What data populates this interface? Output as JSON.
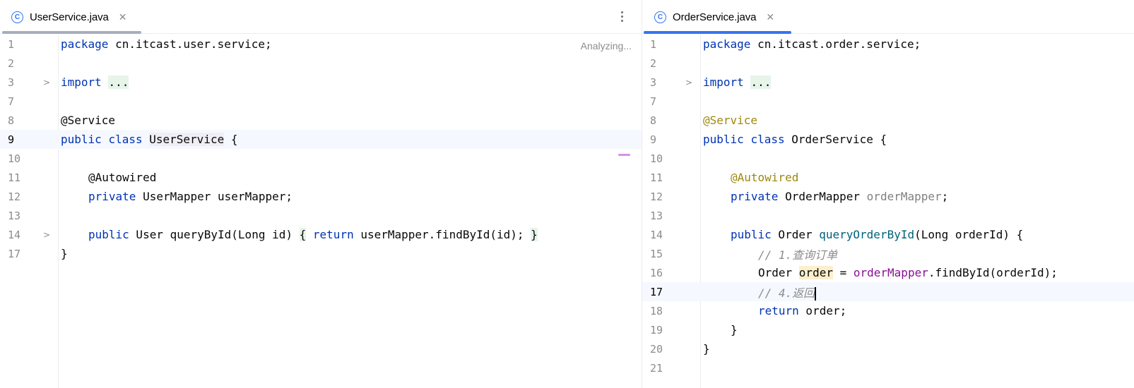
{
  "left": {
    "tab": {
      "icon": "class-icon",
      "icon_glyph": "C",
      "title": "UserService.java",
      "close": "✕"
    },
    "status": "Analyzing...",
    "lines": {
      "l1": {
        "no": "1",
        "kw": "package",
        "rest": " cn.itcast.user.service;"
      },
      "l2": {
        "no": "2"
      },
      "l3": {
        "no": "3",
        "kw": "import",
        "folded": "..."
      },
      "l7": {
        "no": "7"
      },
      "l8": {
        "no": "8",
        "ann": "@Service"
      },
      "l9": {
        "no": "9",
        "kw1": "public",
        "kw2": "class",
        "name": "UserService",
        "brace": " {"
      },
      "l10": {
        "no": "10"
      },
      "l11": {
        "no": "11",
        "ann": "@Autowired"
      },
      "l12": {
        "no": "12",
        "kw": "private",
        "rest": " UserMapper userMapper;"
      },
      "l13": {
        "no": "13"
      },
      "l14": {
        "no": "14",
        "kw": "public",
        "sig": " User queryById(Long id) ",
        "open": "{",
        "ret": "return",
        "body": " userMapper.findById(id); ",
        "close": "}"
      },
      "l17": {
        "no": "17",
        "text": "}"
      }
    }
  },
  "right": {
    "tab": {
      "icon": "class-icon",
      "icon_glyph": "C",
      "title": "OrderService.java",
      "close": "✕"
    },
    "lines": {
      "l1": {
        "no": "1",
        "kw": "package",
        "rest": " cn.itcast.order.service;"
      },
      "l2": {
        "no": "2"
      },
      "l3": {
        "no": "3",
        "kw": "import",
        "folded": "..."
      },
      "l7": {
        "no": "7"
      },
      "l8": {
        "no": "8",
        "ann": "@Service"
      },
      "l9": {
        "no": "9",
        "kw1": "public",
        "kw2": "class",
        "rest": " OrderService {"
      },
      "l10": {
        "no": "10"
      },
      "l11": {
        "no": "11",
        "ann": "@Autowired"
      },
      "l12": {
        "no": "12",
        "kw": "private",
        "type": " OrderMapper ",
        "field": "orderMapper",
        "end": ";"
      },
      "l13": {
        "no": "13"
      },
      "l14": {
        "no": "14",
        "kw": "public",
        "type": " Order ",
        "method": "queryOrderById",
        "rest": "(Long orderId) {"
      },
      "l15": {
        "no": "15",
        "comment": "// 1.查询订单"
      },
      "l16": {
        "no": "16",
        "type": "Order ",
        "var": "order",
        "eq": " = ",
        "field": "orderMapper",
        "rest": ".findById(orderId);"
      },
      "l17": {
        "no": "17",
        "comment": "// 4.返回"
      },
      "l18": {
        "no": "18",
        "kw": "return",
        "rest": " order;"
      },
      "l19": {
        "no": "19",
        "text": "}"
      },
      "l20": {
        "no": "20",
        "text": "}"
      },
      "l21": {
        "no": "21"
      }
    }
  },
  "colors": {
    "keyword": "#0033b3",
    "annotation": "#9e880d",
    "method_decl": "#00627a",
    "field": "#871094",
    "comment": "#8c8c8c",
    "active_tab_underline": "#3574f0",
    "inactive_tab_underline": "#a8adbd"
  }
}
